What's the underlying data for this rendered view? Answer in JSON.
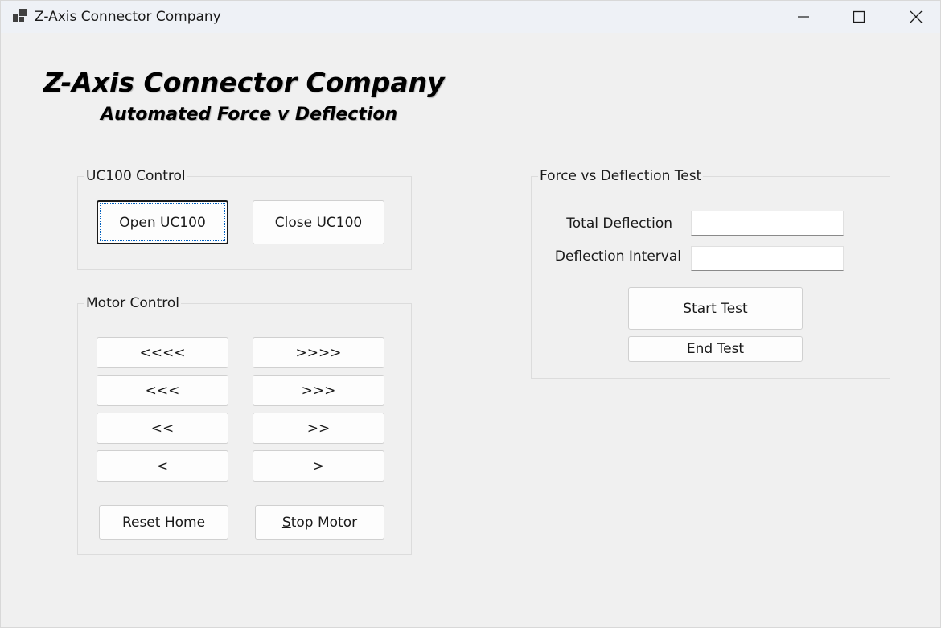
{
  "window": {
    "title": "Z-Axis Connector Company",
    "icon": "app-window-icon",
    "controls": {
      "minimize": "minimize-icon",
      "maximize": "maximize-icon",
      "close": "close-icon"
    }
  },
  "header": {
    "title": "Z-Axis Connector Company",
    "subtitle": "Automated Force v Deflection"
  },
  "uc100": {
    "group_label": "UC100 Control",
    "open_label": "Open UC100",
    "close_label": "Close UC100"
  },
  "motor": {
    "group_label": "Motor Control",
    "left4": "<<<<",
    "right4": ">>>>",
    "left3": "<<<",
    "right3": ">>>",
    "left2": "<<",
    "right2": ">>",
    "left1": "<",
    "right1": ">",
    "reset_home": "Reset Home",
    "stop_motor_first": "S",
    "stop_motor_rest": "top Motor"
  },
  "test": {
    "group_label": "Force vs Deflection Test",
    "total_deflection_label": "Total Deflection",
    "total_deflection_value": "",
    "deflection_interval_label": "Deflection Interval",
    "deflection_interval_value": "",
    "start_label": "Start Test",
    "end_label": "End Test"
  }
}
